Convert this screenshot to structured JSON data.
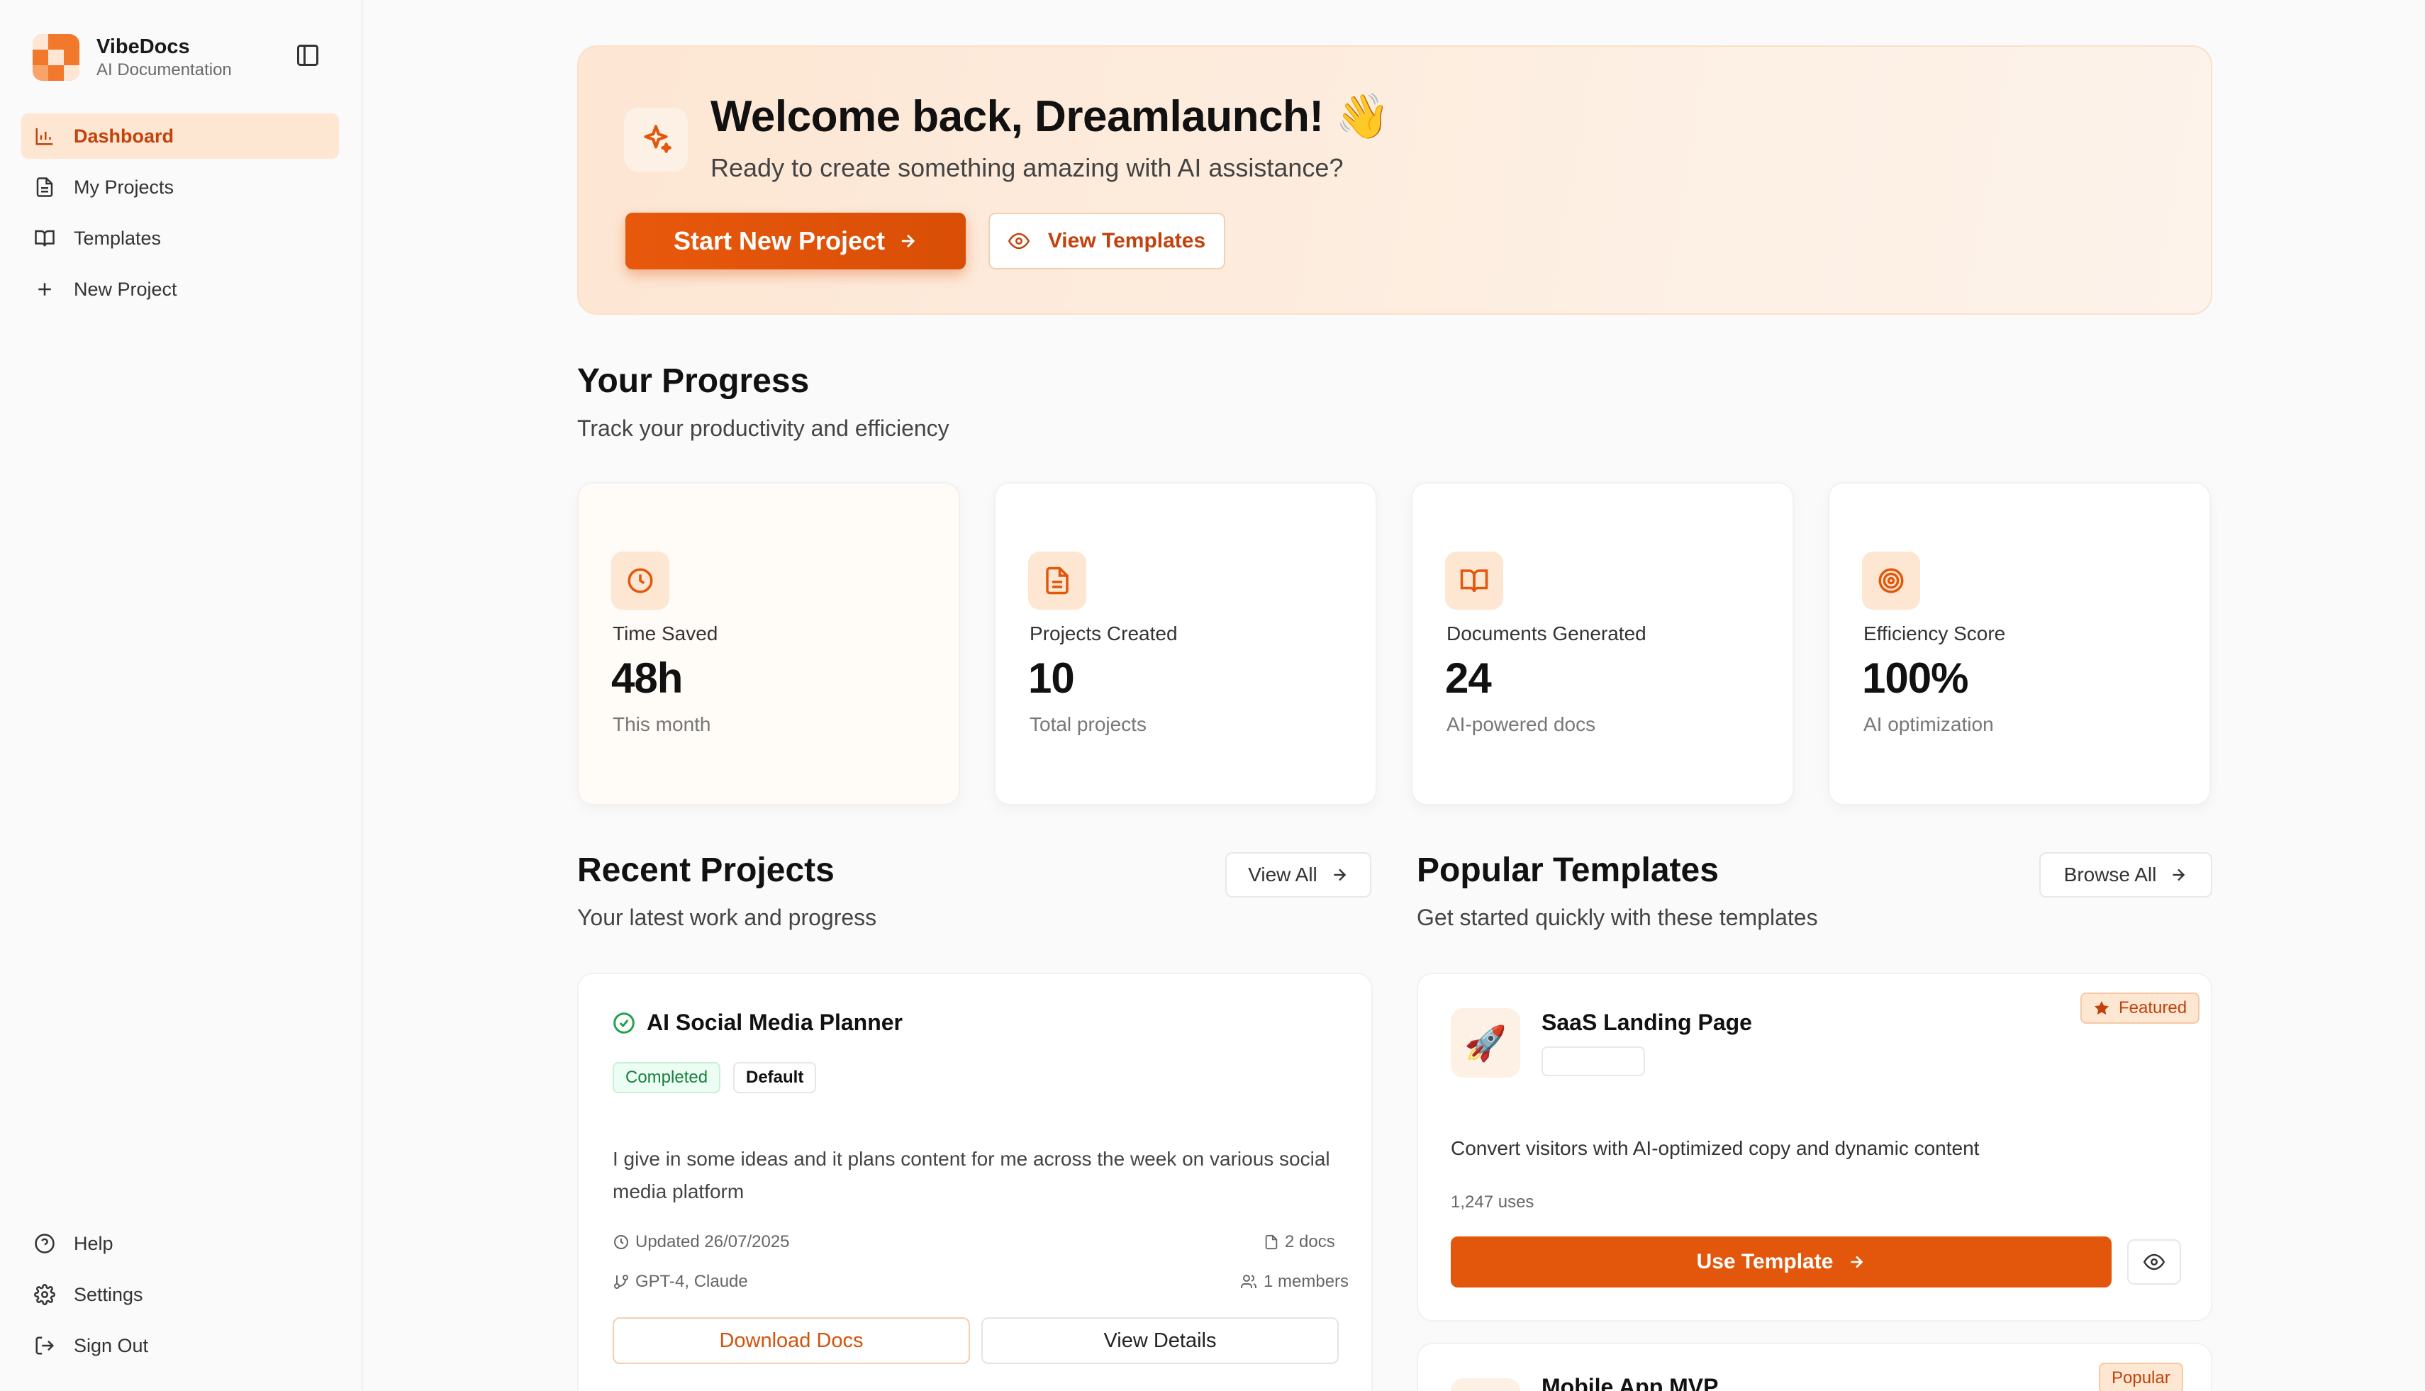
{
  "brand": {
    "name": "VibeDocs",
    "subtitle": "AI Documentation"
  },
  "sidebar": {
    "nav": [
      {
        "label": "Dashboard",
        "icon": "bar-chart-icon",
        "active": true
      },
      {
        "label": "My Projects",
        "icon": "file-icon"
      },
      {
        "label": "Templates",
        "icon": "book-icon"
      },
      {
        "label": "New Project",
        "icon": "plus-icon"
      }
    ],
    "bottom": [
      {
        "label": "Help",
        "icon": "help-circle-icon"
      },
      {
        "label": "Settings",
        "icon": "gear-icon"
      },
      {
        "label": "Sign Out",
        "icon": "sign-out-icon"
      }
    ]
  },
  "hero": {
    "title": "Welcome back, Dreamlaunch! 👋",
    "subtitle": "Ready to create something amazing with AI assistance?",
    "primary_button": "Start New Project",
    "secondary_button": "View Templates"
  },
  "progress": {
    "title": "Your Progress",
    "subtitle": "Track your productivity and efficiency",
    "stats": [
      {
        "label": "Time Saved",
        "value": "48h",
        "sub": "This month",
        "icon": "clock-icon"
      },
      {
        "label": "Projects Created",
        "value": "10",
        "sub": "Total projects",
        "icon": "file-icon"
      },
      {
        "label": "Documents Generated",
        "value": "24",
        "sub": "AI-powered docs",
        "icon": "book-icon"
      },
      {
        "label": "Efficiency Score",
        "value": "100%",
        "sub": "AI optimization",
        "icon": "target-icon"
      }
    ]
  },
  "recent": {
    "title": "Recent Projects",
    "subtitle": "Your latest work and progress",
    "view_all": "View All",
    "project": {
      "name": "AI Social Media Planner",
      "status": "Completed",
      "tag": "Default",
      "description": "I give in some ideas and it plans content for me across the week on various social media platform",
      "updated": "Updated 26/07/2025",
      "docs": "2 docs",
      "models": "GPT-4, Claude",
      "members": "1 members",
      "download_button": "Download Docs",
      "details_button": "View Details"
    }
  },
  "templates": {
    "title": "Popular Templates",
    "subtitle": "Get started quickly with these templates",
    "browse_all": "Browse All",
    "items": [
      {
        "name": "SaaS Landing Page",
        "badge": "Featured",
        "emoji": "🚀",
        "description": "Convert visitors with AI-optimized copy and dynamic content",
        "uses": "1,247 uses",
        "use_button": "Use Template"
      },
      {
        "name": "Mobile App MVP",
        "badge": "Popular"
      }
    ]
  },
  "colors": {
    "accent": "#e2570b",
    "accent_soft": "#fde7d2",
    "success": "#16803c"
  }
}
